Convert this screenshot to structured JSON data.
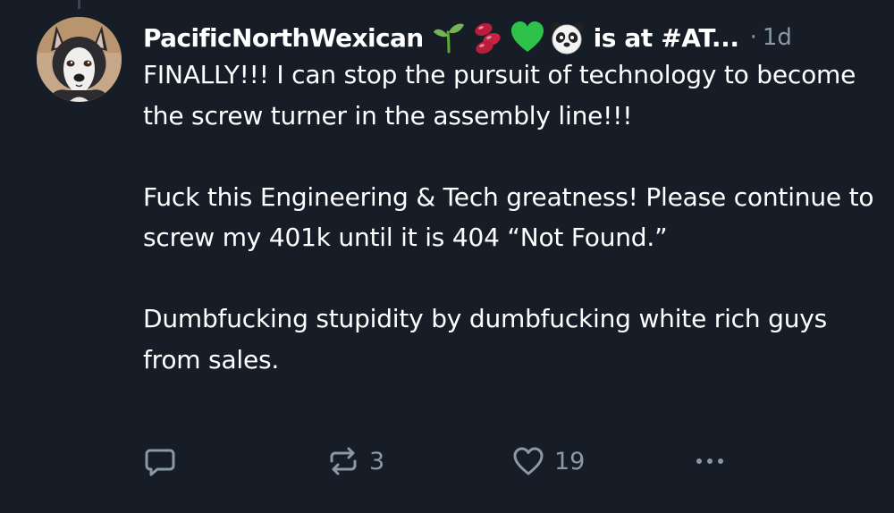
{
  "post": {
    "author": {
      "display_name": "PacificNorthWexican",
      "name_emojis": [
        "seedling-emoji",
        "beans-emoji",
        "green-heart-emoji",
        "panda-emoji"
      ],
      "status_text": "is at #AT...",
      "avatar": "husky-dog-avatar"
    },
    "separator": "·",
    "timestamp": "1d",
    "paragraphs": [
      "FINALLY!!! I can stop the pursuit of technology to become the screw turner in the assembly line!!!",
      "Fuck this Engineering & Tech greatness! Please continue to screw my 401k until it is 404 “Not Found.”",
      "Dumbfucking stupidity by dumbfucking white rich guys from sales."
    ],
    "actions": {
      "reply_icon": "speech-bubble-icon",
      "repost_icon": "repost-arrows-icon",
      "repost_count": "3",
      "like_icon": "heart-outline-icon",
      "like_count": "19",
      "more_icon": "more-dots-icon"
    }
  },
  "colors": {
    "background": "#161d27",
    "text_primary": "#ffffff",
    "text_muted": "#8b98a6"
  }
}
